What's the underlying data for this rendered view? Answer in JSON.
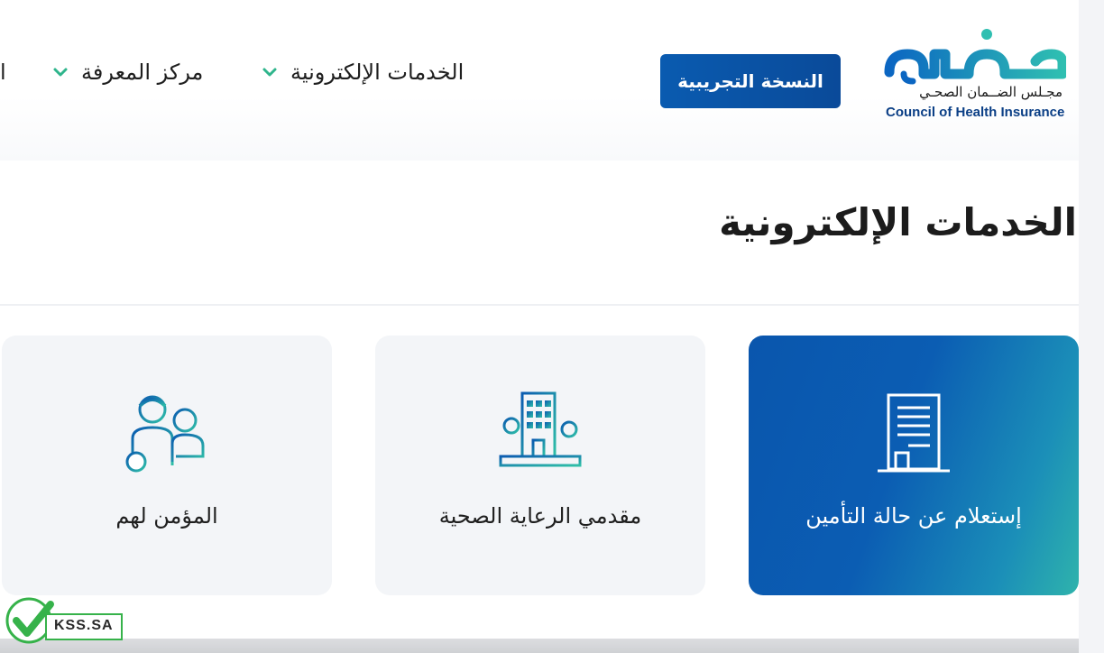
{
  "header": {
    "logo": {
      "wordmark_ar": "ضمان",
      "subtitle_ar": "مجـلس الضــمان الصحـي",
      "name_en": "Council of Health Insurance"
    },
    "beta_button": "النسخة التجريبية",
    "nav": [
      {
        "label": "الخدمات الإلكترونية",
        "icon": "chevron-down-icon"
      },
      {
        "label": "مركز المعرفة",
        "icon": "chevron-down-icon"
      },
      {
        "label": "ا"
      }
    ]
  },
  "main": {
    "title": "الخدمات الإلكترونية",
    "cards": [
      {
        "label": "إستعلام عن حالة التأمين",
        "icon": "document-building-icon",
        "active": true
      },
      {
        "label": "مقدمي الرعاية الصحية",
        "icon": "hospital-building-icon",
        "active": false
      },
      {
        "label": "المؤمن لهم",
        "icon": "insured-people-icon",
        "active": false
      }
    ]
  },
  "watermark": {
    "text": "KSS.SA",
    "icon": "checkmark-icon"
  },
  "colors": {
    "brand_blue": "#0a56ad",
    "brand_teal": "#2fb3ac",
    "chevron_green": "#2fb58c",
    "card_bg": "#f3f5f8"
  }
}
